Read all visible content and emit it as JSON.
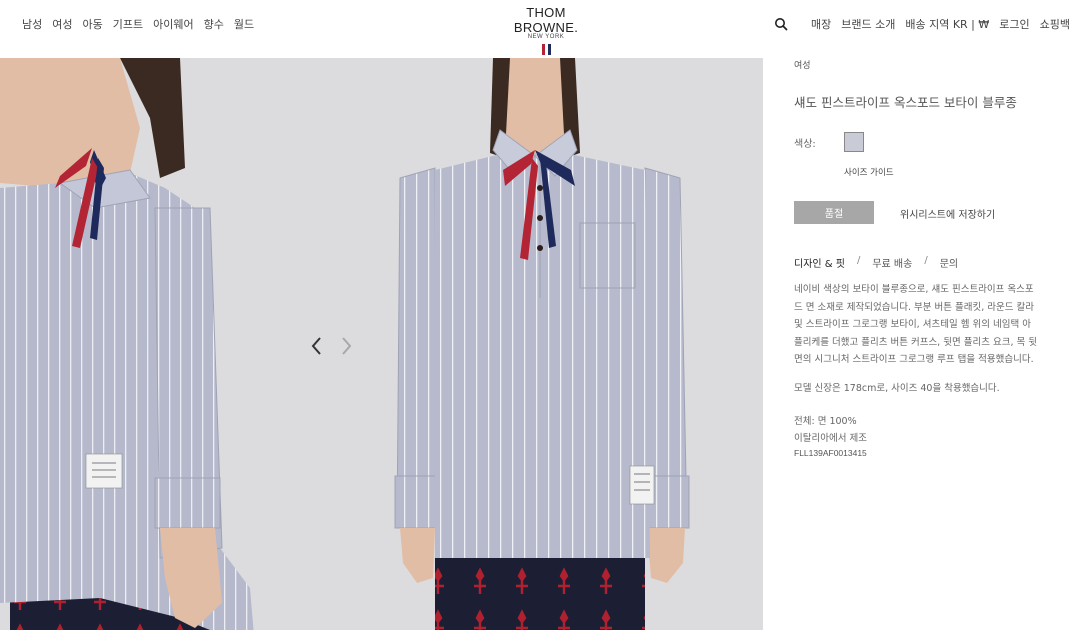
{
  "nav": {
    "left_items": [
      "남성",
      "여성",
      "아동",
      "기프트",
      "아이웨어",
      "향수",
      "월드"
    ],
    "right_items": [
      "매장",
      "브랜드 소개",
      "배송 지역 KR | ₩",
      "로그인",
      "쇼핑백"
    ]
  },
  "logo": {
    "main": "THOM BROWNE.",
    "sub": "NEW YORK",
    "flag_colors": [
      "#b32535",
      "#ffffff",
      "#1f2a5c"
    ]
  },
  "product": {
    "breadcrumb": "여성",
    "title": "섀도 핀스트라이프 옥스포드 보타이 블루종",
    "color_label": "색상:",
    "swatch_color": "#c9ccd6",
    "size_guide": "사이즈 가이드",
    "soldout_label": "품절",
    "wishlist_label": "위시리스트에 저장하기",
    "tabs": [
      "디자인 & 핏",
      "무료 배송",
      "문의"
    ],
    "description_lines": [
      "네이비 색상의 보타이 블루종으로, 섀도 핀스트라이프 옥스포",
      "드 면 소재로 제작되었습니다. 부분 버튼 플래킷, 라운드 칼라",
      "및 스트라이프 그로그랭 보타이, 셔츠테일 헴 위의 네임택 아",
      "플리케를 더했고 플리츠 버튼 커프스, 뒷면 플리츠 요크, 목 뒷",
      "면의 시그니처 스트라이프 그로그랭 루프 탭을 적용했습니다."
    ],
    "model_info": "모델 신장은 178cm로, 사이즈 40을 착용했습니다.",
    "material": "전체: 면 100%",
    "origin": "이탈리아에서 제조",
    "sku": "FLL139AF0013415"
  },
  "gallery": {
    "background": "#dcdcde",
    "icons": [
      "chevron-left-icon",
      "chevron-right-icon"
    ]
  }
}
